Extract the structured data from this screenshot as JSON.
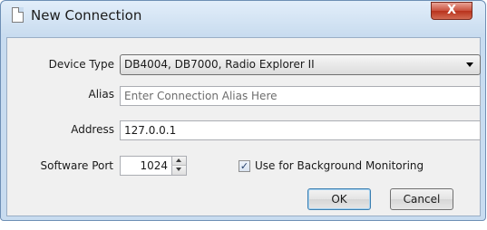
{
  "window": {
    "title": "New Connection",
    "close_symbol": "X"
  },
  "form": {
    "device_type": {
      "label": "Device Type",
      "selected": "DB4004, DB7000, Radio Explorer II"
    },
    "alias": {
      "label": "Alias",
      "value": "",
      "placeholder": "Enter Connection Alias Here"
    },
    "address": {
      "label": "Address",
      "value": "127.0.0.1"
    },
    "software_port": {
      "label": "Software Port",
      "value": "1024"
    },
    "background_monitoring": {
      "label": "Use for Background Monitoring",
      "checked": true,
      "check_glyph": "✓"
    }
  },
  "buttons": {
    "ok": "OK",
    "cancel": "Cancel"
  },
  "icons": {
    "window_icon": "document-icon",
    "combo_arrow": "chevron-down-icon",
    "spin_up": "arrow-up-icon",
    "spin_down": "arrow-down-icon"
  },
  "colors": {
    "title_bar": "#c9dcef",
    "close_button": "#c9503c",
    "dialog_body": "#f0f0f0",
    "default_button_border": "#3c7fb1"
  }
}
